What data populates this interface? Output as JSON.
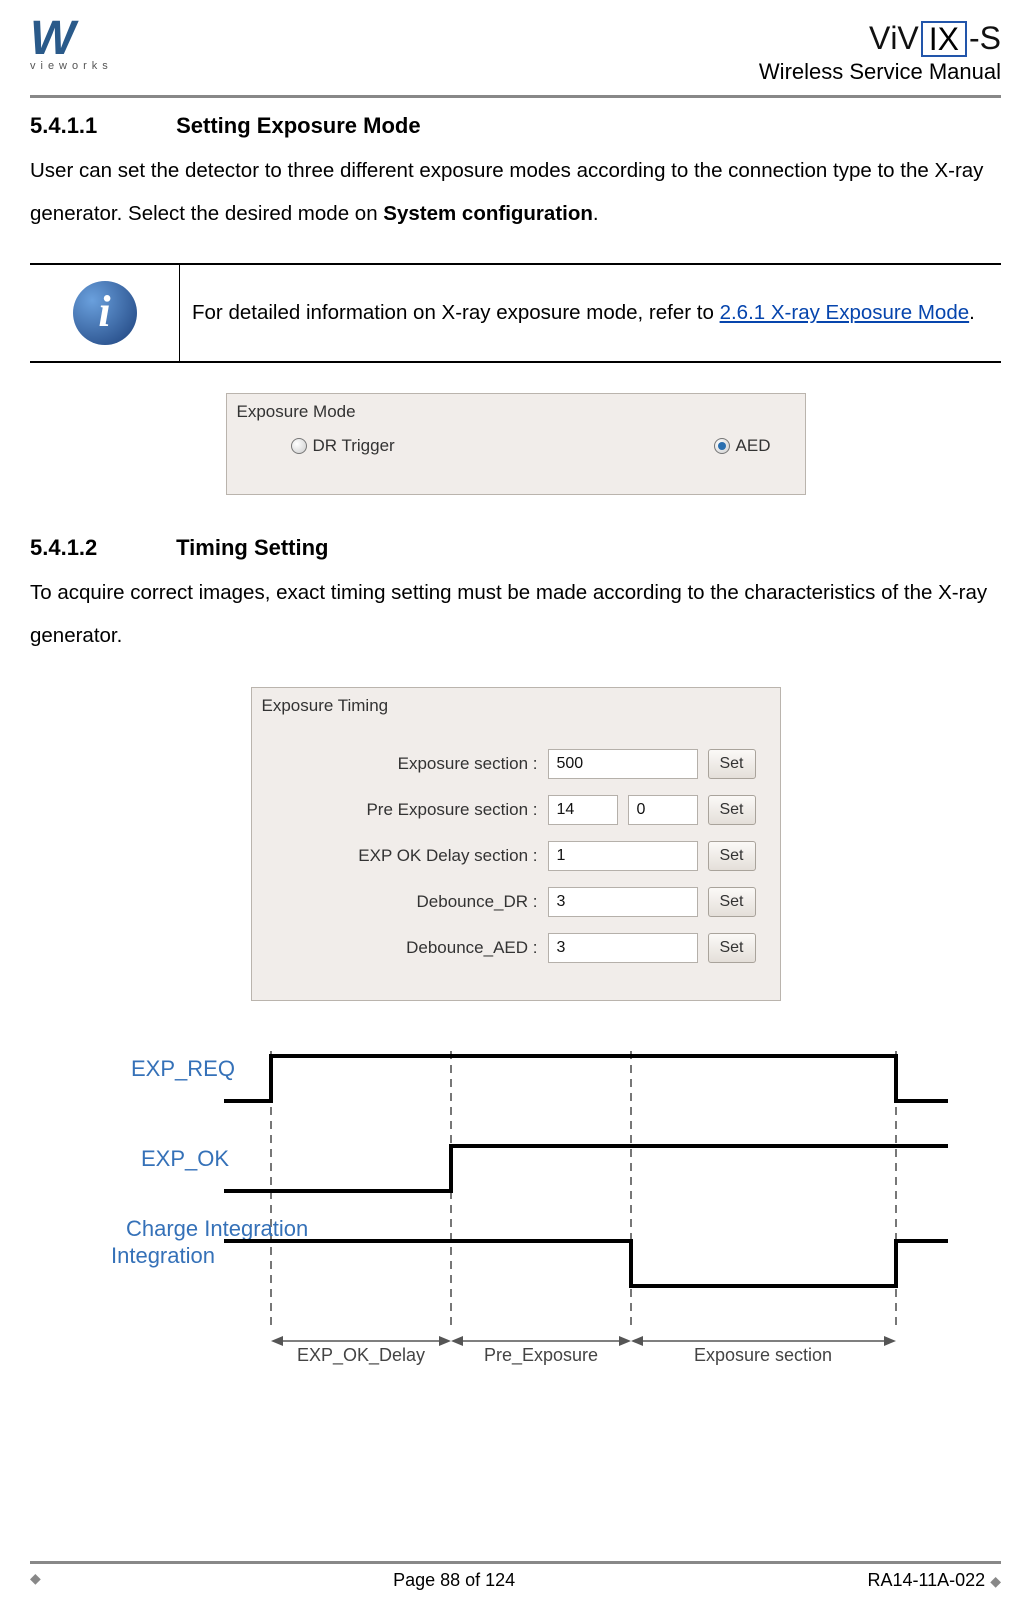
{
  "header": {
    "brand": "vieworks",
    "product": "ViVIX-S",
    "doc_title": "Wireless Service Manual"
  },
  "section1": {
    "num": "5.4.1.1",
    "title": "Setting Exposure Mode",
    "p1_a": "User can set the detector to three different exposure modes according to the connection type to the X-ray generator. Select the desired mode on ",
    "p1_bold": "System configuration",
    "p1_b": "."
  },
  "info": {
    "text_a": "For detailed information on X-ray exposure mode, refer to ",
    "link": "2.6.1 X-ray Exposure Mode",
    "text_b": "."
  },
  "expmode_panel": {
    "title": "Exposure Mode",
    "opt1": "DR Trigger",
    "opt2": "AED",
    "selected": "AED"
  },
  "section2": {
    "num": "5.4.1.2",
    "title": "Timing Setting",
    "p1": "To acquire correct images, exact timing setting must be made according to the characteristics of the X-ray generator."
  },
  "timing_panel": {
    "title": "Exposure Timing",
    "rows": [
      {
        "label": "Exposure section :",
        "v1": "500",
        "v2": null,
        "btn": "Set"
      },
      {
        "label": "Pre Exposure section :",
        "v1": "14",
        "v2": "0",
        "btn": "Set"
      },
      {
        "label": "EXP OK Delay section :",
        "v1": "1",
        "v2": null,
        "btn": "Set"
      },
      {
        "label": "Debounce_DR :",
        "v1": "3",
        "v2": null,
        "btn": "Set"
      },
      {
        "label": "Debounce_AED :",
        "v1": "3",
        "v2": null,
        "btn": "Set"
      }
    ]
  },
  "diagram": {
    "sig1": "EXP_REQ",
    "sig2": "EXP_OK",
    "sig3": "Charge Integration",
    "lab1": "EXP_OK_Delay",
    "lab2": "Pre_Exposure",
    "lab3": "Exposure section"
  },
  "footer": {
    "page": "Page 88 of 124",
    "doc": "RA14-11A-022"
  }
}
